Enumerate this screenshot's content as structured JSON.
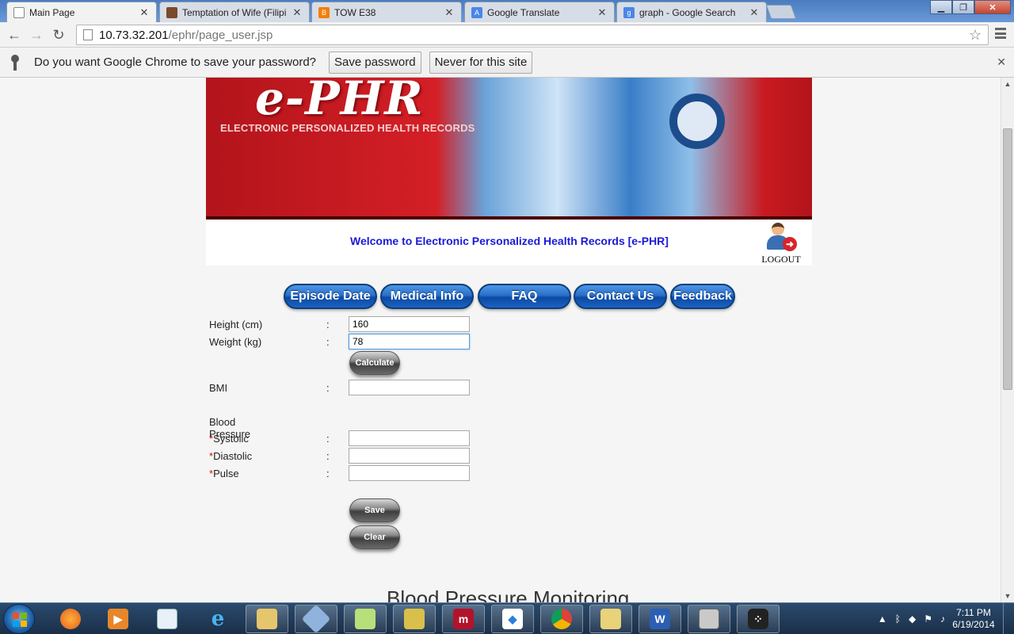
{
  "browser": {
    "tabs": [
      {
        "title": "Main Page",
        "icon": "page-icon",
        "active": true
      },
      {
        "title": "Temptation of Wife (Filipi",
        "icon": "tv-show-icon"
      },
      {
        "title": "TOW E38",
        "icon": "blogger-icon"
      },
      {
        "title": "Google Translate",
        "icon": "google-translate-icon"
      },
      {
        "title": "graph - Google Search",
        "icon": "google-search-icon"
      }
    ],
    "close_glyph": "✕",
    "url_host": "10.73.32.201",
    "url_path": "/ephr/page_user.jsp",
    "infobar": {
      "message": "Do you want Google Chrome to save your password?",
      "save_label": "Save password",
      "never_label": "Never for this site"
    }
  },
  "site": {
    "logo": "e-PHR",
    "tagline": "ELECTRONIC PERSONALIZED HEALTH RECORDS",
    "welcome": "Welcome to Electronic Personalized Health Records [e-PHR]",
    "logout_label": "LOGOUT",
    "nav": [
      "Episode Date",
      "Medical Info",
      "FAQ",
      "Contact Us",
      "Feedback"
    ]
  },
  "form": {
    "height_label": "Height (cm)",
    "height_value": "160",
    "weight_label": "Weight (kg)",
    "weight_value": "78",
    "colon": ":",
    "calculate_label": "Calculate",
    "bmi_label": "BMI",
    "bmi_value": "",
    "bp_title": "Blood Pressure",
    "required_mark": "*",
    "systolic_label": "Systolic",
    "diastolic_label": "Diastolic",
    "pulse_label": "Pulse",
    "save_label": "Save",
    "clear_label": "Clear"
  },
  "chart_heading": "Blood Pressure Monitoring",
  "taskbar": {
    "apps": [
      "firefox-icon",
      "media-player-icon",
      "notepad-icon",
      "internet-explorer-icon",
      "file-explorer-icon",
      "virtualbox-icon",
      "notepad-plus-icon",
      "puzzle-app-icon",
      "mendeley-icon",
      "dropbox-icon",
      "chrome-icon",
      "folder-icon",
      "word-icon",
      "remote-desktop-icon",
      "blackberry-icon"
    ],
    "time": "7:11 PM",
    "date": "6/19/2014"
  },
  "colors": {
    "nav_blue": "#1c63c2",
    "welcome_blue": "#1a1ad8",
    "banner_red": "#d41f26",
    "required_red": "#d01010"
  }
}
